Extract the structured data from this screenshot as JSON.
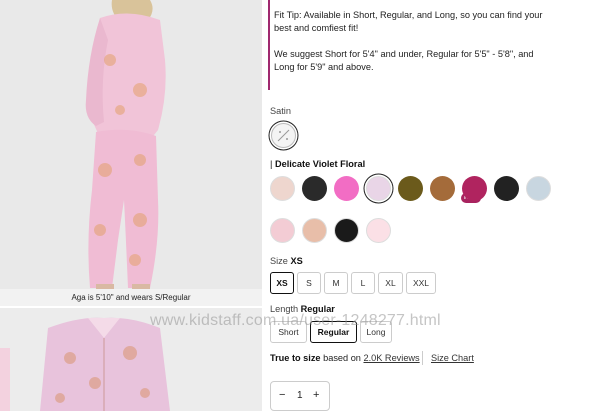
{
  "gallery": {
    "caption": "Aga is 5'10\" and wears S/Regular"
  },
  "fit_tip": {
    "line1": "Fit Tip: Available in Short, Regular, and Long, so you can find your best and comfiest fit!",
    "line2": "We suggest Short for 5'4\" and under, Regular for 5'5\" - 5'8\", and Long for 5'9\" and above."
  },
  "fabric": {
    "label": "Satin"
  },
  "color": {
    "prefix": "|",
    "selected_name": "Delicate Violet Floral",
    "swatches_row1": [
      "#eed6ce",
      "#2a2a2a",
      "#f26dc4",
      "#e9d5e7",
      "#6b5a1b",
      "#a46b3a",
      "#b0245f",
      "#222222",
      "#c8d6e0"
    ],
    "swatches_row2": [
      "#f3ccd4",
      "#e8bea9",
      "#1a1a1a",
      "#fbe0e6"
    ],
    "new_badge": "New"
  },
  "size": {
    "label": "Size",
    "selected": "XS",
    "options": [
      "XS",
      "S",
      "M",
      "L",
      "XL",
      "XXL"
    ]
  },
  "length": {
    "label": "Length",
    "selected": "Regular",
    "options": [
      "Short",
      "Regular",
      "Long"
    ]
  },
  "reviews": {
    "true_to_size": "True to size",
    "based_on": "based on",
    "count_link": "2.0K Reviews",
    "size_chart": "Size Chart"
  },
  "quantity": {
    "minus": "−",
    "value": "1",
    "plus": "+"
  },
  "watermark": "www.kidstaff.com.ua/user-1248277.html"
}
